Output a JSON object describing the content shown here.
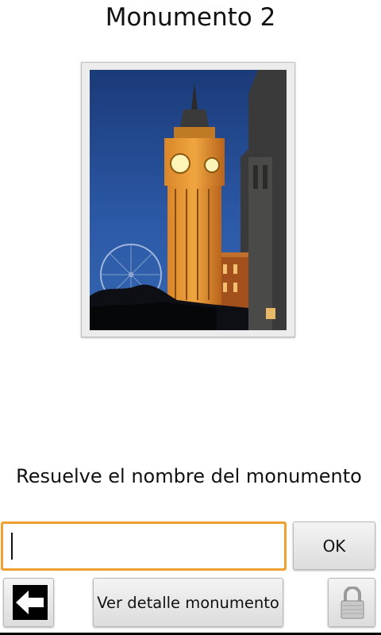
{
  "screen": {
    "title": "Monumento 2",
    "prompt": "Resuelve el nombre del monumento"
  },
  "answer": {
    "value": "",
    "placeholder": ""
  },
  "buttons": {
    "ok_label": "OK",
    "detail_label": "Ver detalle monumento"
  },
  "icons": {
    "back": "arrow-left-icon",
    "lock": "padlock-icon"
  },
  "colors": {
    "input_focus_border": "#f0a030",
    "background": "#ffffff"
  }
}
